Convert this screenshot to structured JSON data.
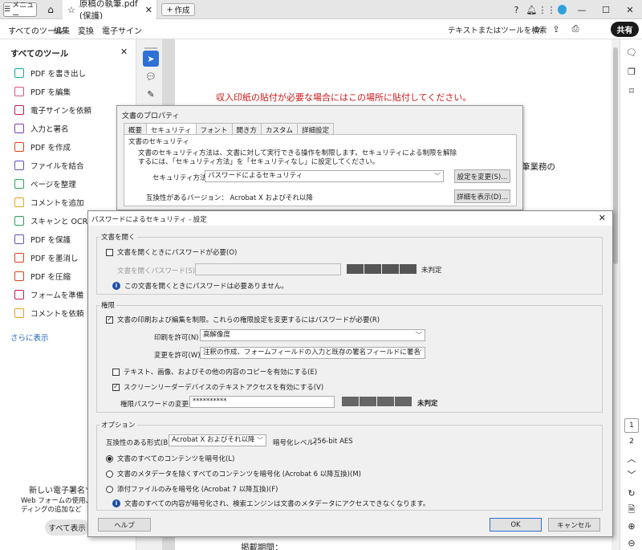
{
  "titlebar": {
    "menu_label": "メニュー",
    "tab_title": "原稿の執筆.pdf (保護)",
    "create_label": "作成"
  },
  "menubar": {
    "items": [
      "すべてのツール",
      "編集",
      "変換",
      "電子サイン"
    ],
    "search_text": "テキストまたはツールを検索",
    "share_label": "共有"
  },
  "sidebar": {
    "heading": "すべてのツール",
    "tools": [
      {
        "label": "PDF を書き出し",
        "color": "#1aa3a3"
      },
      {
        "label": "PDF を編集",
        "color": "#d94f8a"
      },
      {
        "label": "電子サインを依頼",
        "color": "#c2185b"
      },
      {
        "label": "入力と署名",
        "color": "#7b3fb8"
      },
      {
        "label": "PDF を作成",
        "color": "#e0401a"
      },
      {
        "label": "ファイルを結合",
        "color": "#6a4ec2"
      },
      {
        "label": "ページを整理",
        "color": "#2aa05a"
      },
      {
        "label": "コメントを追加",
        "color": "#e8a11a"
      },
      {
        "label": "スキャンと OCR",
        "color": "#2aa05a"
      },
      {
        "label": "PDF を保護",
        "color": "#6a4ec2"
      },
      {
        "label": "PDF を墨消し",
        "color": "#e0401a"
      },
      {
        "label": "PDF を圧縮",
        "color": "#e0401a"
      },
      {
        "label": "フォームを準備",
        "color": "#c2185b"
      },
      {
        "label": "コメントを依頼",
        "color": "#e8a11a"
      }
    ],
    "more_link": "さらに表示",
    "promo_title": "新しい電子署名ツール",
    "promo_text": "Web フォームの使用、一括\nディングの追加など",
    "show_all_label": "すべて表示"
  },
  "document": {
    "red_line": "収入印紙の貼付が必要な場合にはこの場所に貼付してください。",
    "fragment": "筆業務の",
    "bottom_text": "掲載期間："
  },
  "rightrail": {
    "pages": [
      "1",
      "2"
    ]
  },
  "doc_props": {
    "title": "文書のプロパティ",
    "tabs": [
      "概要",
      "セキュリティ",
      "フォント",
      "開き方",
      "カスタム",
      "詳細設定"
    ],
    "group": "文書のセキュリティ",
    "desc_line1": "文書のセキュリティ方法は、文書に対して実行できる操作を制限します。セキュリティによる制限を解除",
    "desc_line2": "するには、「セキュリティ方法」を「セキュリティなし」に設定してください。",
    "method_label": "セキュリティ方法(M)：",
    "method_value": "パスワードによるセキュリティ",
    "change_settings": "設定を変更(S)...",
    "compat_label": "互換性があるバージョン：",
    "compat_value": "Acrobat X およびそれ以降",
    "show_details": "詳細を表示(D)..."
  },
  "pwd": {
    "title": "パスワードによるセキュリティ - 設定",
    "open_group": "文書を開く",
    "require_open": "文書を開くときにパスワードが必要(O)",
    "open_pwd_label": "文書を開くパスワード(S)：",
    "open_rating": "未判定",
    "open_info": "この文書を開くときにパスワードは必要ありません。",
    "perm_group": "権限",
    "restrict": "文書の印刷および編集を制限。これらの権限設定を変更するにはパスワードが必要(R)",
    "print_label": "印刷を許可(N)：",
    "print_value": "高解像度",
    "change_label": "変更を許可(W)：",
    "change_value": "注釈の作成、フォームフィールドの入力と既存の署名フィールドに署名",
    "copy_enable": "テキスト、画像、およびその他の内容のコピーを有効にする(E)",
    "screen_reader": "スクリーンリーダーデバイスのテキストアクセスを有効にする(V)",
    "perm_pwd_label": "権限パスワードの変更(P)：",
    "perm_pwd_value": "**********",
    "perm_rating": "未判定",
    "options_group": "オプション",
    "compat_label": "互換性のある形式(B)：",
    "compat_value": "Acrobat X およびそれ以降",
    "enc_level_label": "暗号化レベル：",
    "enc_level_value": "256-bit AES",
    "enc_all": "文書のすべてのコンテンツを暗号化(L)",
    "enc_except_meta": "文書のメタデータを除くすべてのコンテンツを暗号化 (Acrobat 6 以降互換)(M)",
    "enc_attach": "添付ファイルのみを暗号化 (Acrobat 7 以降互換)(F)",
    "enc_info": "文書のすべての内容が暗号化され、検索エンジンは文書のメタデータにアクセスできなくなります。",
    "help": "ヘルプ",
    "ok": "OK",
    "cancel": "キャンセル"
  }
}
